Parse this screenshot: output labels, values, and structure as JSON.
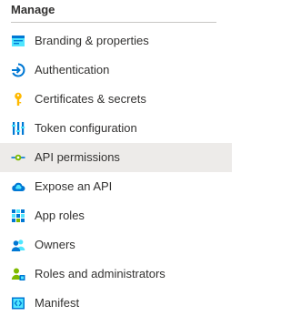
{
  "section": {
    "title": "Manage"
  },
  "items": [
    {
      "label": "Branding & properties",
      "icon": "branding-icon"
    },
    {
      "label": "Authentication",
      "icon": "authentication-icon"
    },
    {
      "label": "Certificates & secrets",
      "icon": "key-icon"
    },
    {
      "label": "Token configuration",
      "icon": "token-configuration-icon"
    },
    {
      "label": "API permissions",
      "icon": "api-permissions-icon",
      "selected": true
    },
    {
      "label": "Expose an API",
      "icon": "cloud-icon"
    },
    {
      "label": "App roles",
      "icon": "app-roles-grid-icon"
    },
    {
      "label": "Owners",
      "icon": "owners-icon"
    },
    {
      "label": "Roles and administrators",
      "icon": "roles-administrators-icon"
    },
    {
      "label": "Manifest",
      "icon": "manifest-icon"
    }
  ],
  "colors": {
    "selected_background": "#edebe9",
    "text": "#323130",
    "accent_blue": "#0078d4"
  }
}
